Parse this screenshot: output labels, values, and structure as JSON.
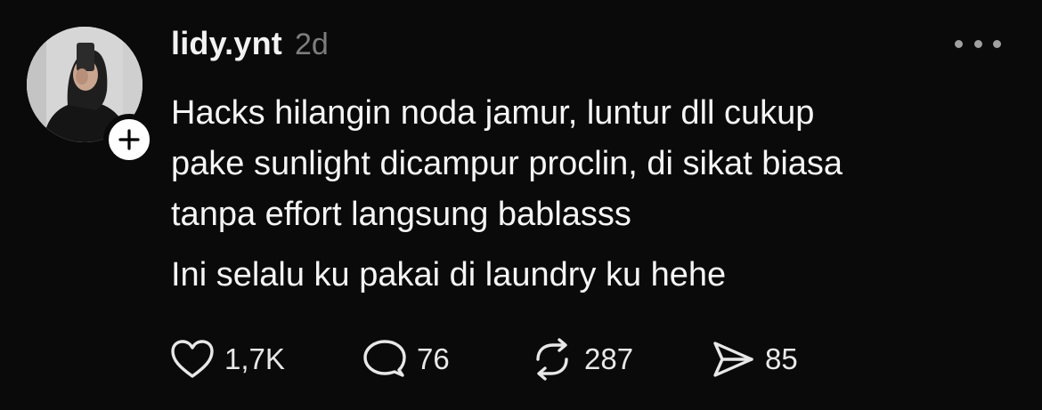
{
  "post": {
    "username": "lidy.ynt",
    "timestamp": "2d",
    "body_lines": [
      "Hacks hilangin noda jamur, luntur dll cukup",
      "pake sunlight dicampur proclin, di sikat biasa",
      "tanpa effort langsung bablasss"
    ],
    "body_extra": "Ini selalu ku pakai di laundry ku hehe"
  },
  "actions": {
    "likes": "1,7K",
    "comments": "76",
    "reposts": "287",
    "shares": "85"
  },
  "icons": {
    "like": "heart-icon",
    "comment": "speech-bubble-icon",
    "repost": "repost-arrows-icon",
    "share": "send-icon",
    "more": "more-dots-icon",
    "follow": "plus-icon"
  },
  "colors": {
    "background": "#0a0a0a",
    "text": "#f5f5f5",
    "muted": "#7d7d7d",
    "icon": "#e8e8e8"
  }
}
